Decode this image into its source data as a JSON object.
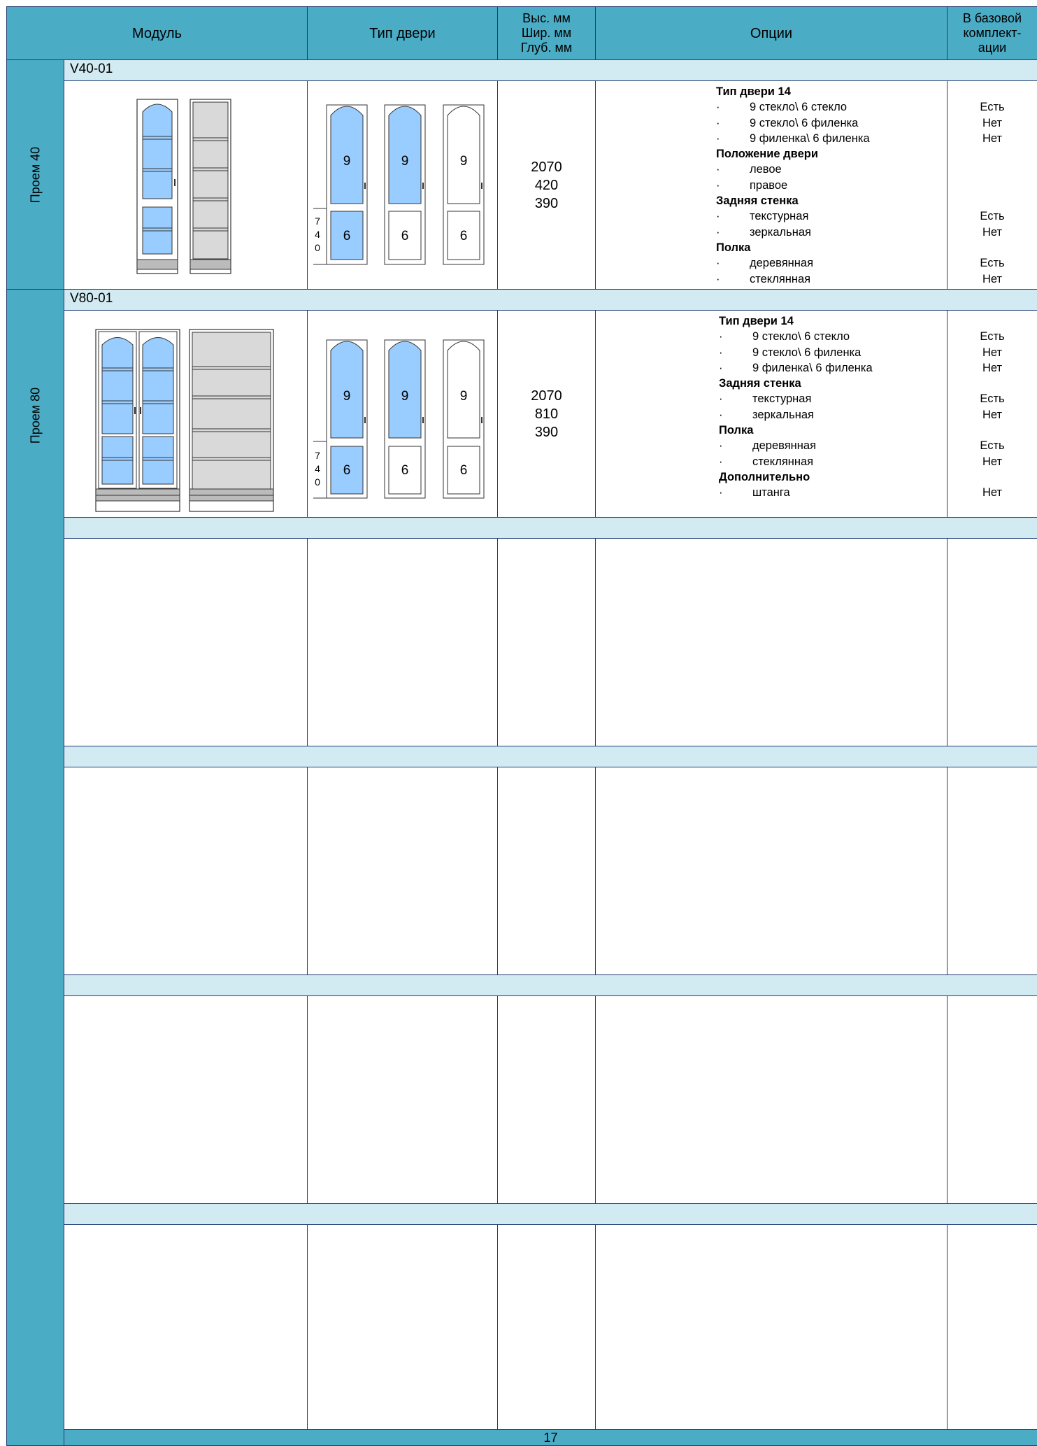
{
  "header": {
    "module": "Модуль",
    "door_type": "Тип двери",
    "dims_h": "Выс. мм",
    "dims_w": "Шир. мм",
    "dims_d": "Глуб. мм",
    "options": "Опции",
    "base_1": "В базовой",
    "base_2": "комплект-",
    "base_3": "ации"
  },
  "sections": [
    {
      "side_label": "Проем 40",
      "code": "V40-01",
      "dims": [
        "2070",
        "420",
        "390"
      ],
      "door_labels": {
        "top": "9",
        "bottom": "6",
        "dim": [
          "7",
          "4",
          "0"
        ]
      },
      "options": [
        {
          "kind": "h",
          "text": "Тип двери 14",
          "base": ""
        },
        {
          "kind": "i",
          "bullet": "·",
          "text": "9 стекло\\ 6 стекло",
          "base": "Есть"
        },
        {
          "kind": "i",
          "bullet": "·",
          "text": "9 стекло\\ 6 филенка",
          "base": "Нет"
        },
        {
          "kind": "i",
          "bullet": "·",
          "text": "9 филенка\\ 6 филенка",
          "base": "Нет"
        },
        {
          "kind": "h",
          "text": "Положение двери",
          "base": ""
        },
        {
          "kind": "i",
          "bullet": "·",
          "text": "левое",
          "base": ""
        },
        {
          "kind": "i",
          "bullet": "·",
          "text": "правое",
          "base": ""
        },
        {
          "kind": "h",
          "text": "Задняя стенка",
          "base": ""
        },
        {
          "kind": "i",
          "bullet": "·",
          "text": "текстурная",
          "base": "Есть"
        },
        {
          "kind": "i",
          "bullet": "·",
          "text": "зеркальная",
          "base": "Нет"
        },
        {
          "kind": "h",
          "text": "Полка",
          "base": ""
        },
        {
          "kind": "i",
          "bullet": "·",
          "text": "деревянная",
          "base": "Есть"
        },
        {
          "kind": "i",
          "bullet": "·",
          "text": "стеклянная",
          "base": "Нет"
        }
      ]
    },
    {
      "side_label": "Проем 80",
      "code": "V80-01",
      "dims": [
        "2070",
        "810",
        "390"
      ],
      "door_labels": {
        "top": "9",
        "bottom": "6",
        "dim": [
          "7",
          "4",
          "0"
        ]
      },
      "options": [
        {
          "kind": "h",
          "text": "Тип двери 14",
          "base": ""
        },
        {
          "kind": "i",
          "bullet": "·",
          "text": "9 стекло\\ 6 стекло",
          "base": "Есть"
        },
        {
          "kind": "i",
          "bullet": "·",
          "text": "9 стекло\\ 6 филенка",
          "base": "Нет"
        },
        {
          "kind": "i",
          "bullet": "·",
          "text": "9 филенка\\ 6 филенка",
          "base": "Нет"
        },
        {
          "kind": "h",
          "text": "Задняя стенка",
          "base": ""
        },
        {
          "kind": "i",
          "bullet": "·",
          "text": "текстурная",
          "base": "Есть"
        },
        {
          "kind": "i",
          "bullet": "·",
          "text": "зеркальная",
          "base": "Нет"
        },
        {
          "kind": "h",
          "text": "Полка",
          "base": ""
        },
        {
          "kind": "i",
          "bullet": "·",
          "text": "деревянная",
          "base": "Есть"
        },
        {
          "kind": "i",
          "bullet": "·",
          "text": "стеклянная",
          "base": "Нет"
        },
        {
          "kind": "h",
          "text": "Дополнительно",
          "base": ""
        },
        {
          "kind": "i",
          "bullet": "·",
          "text": "штанга",
          "base": "Нет"
        }
      ]
    }
  ],
  "page_number": "17",
  "colors": {
    "header_bg": "#4bacc6",
    "band_bg": "#d2eaf1",
    "border": "#1f3b73",
    "glass": "#99ccff"
  }
}
